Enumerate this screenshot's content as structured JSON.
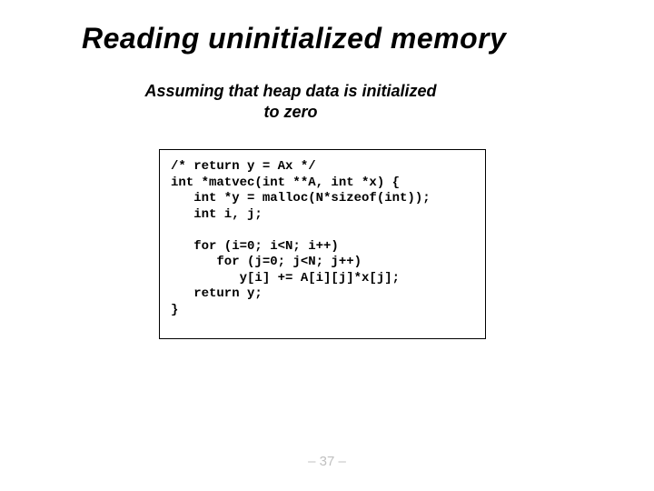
{
  "slide": {
    "title": "Reading uninitialized memory",
    "subtitle_line1": "Assuming that heap data is initialized",
    "subtitle_line2": "to zero",
    "code": "/* return y = Ax */\nint *matvec(int **A, int *x) {\n   int *y = malloc(N*sizeof(int));\n   int i, j;\n\n   for (i=0; i<N; i++)\n      for (j=0; j<N; j++)\n         y[i] += A[i][j]*x[j];\n   return y;\n}",
    "page_number": "– 37 –"
  }
}
